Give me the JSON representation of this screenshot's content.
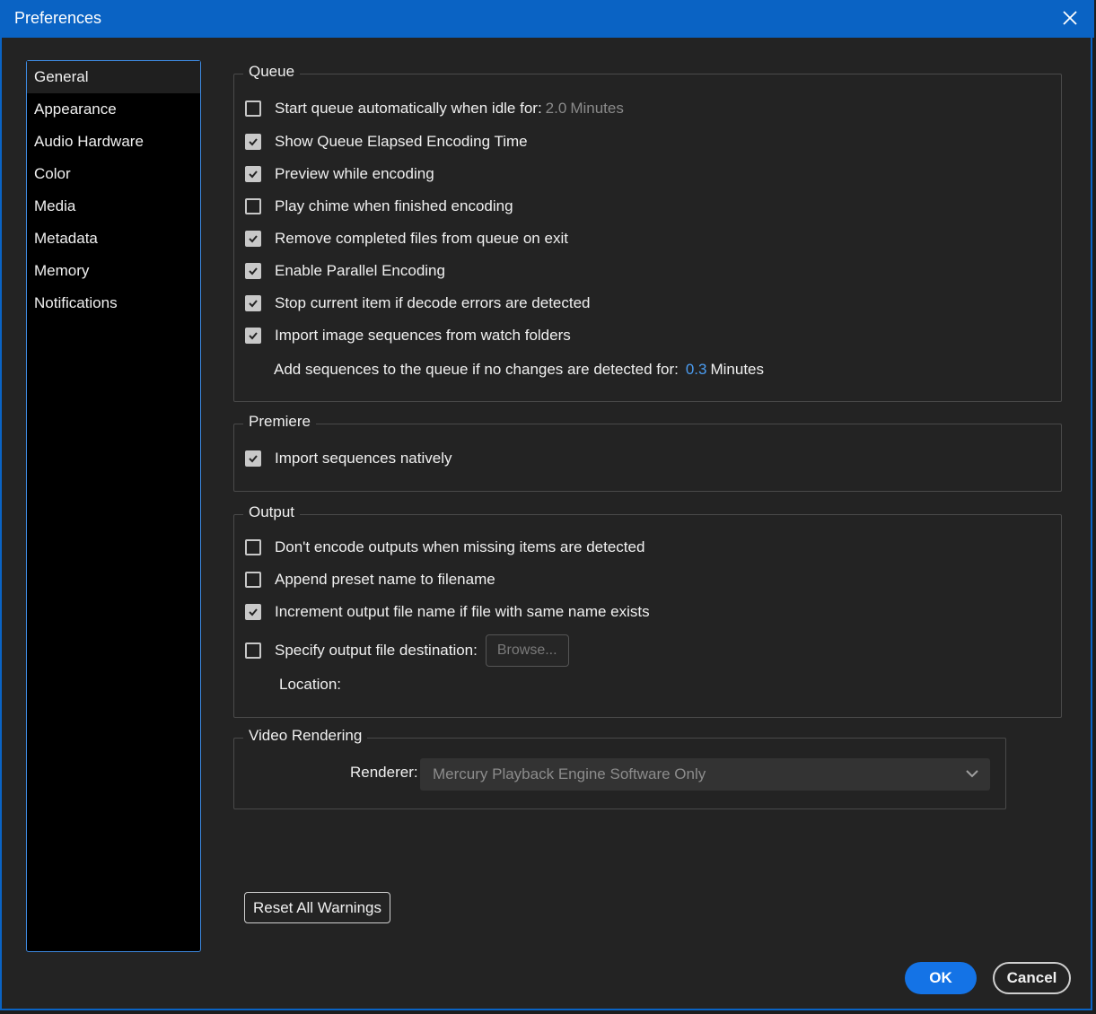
{
  "window": {
    "title": "Preferences"
  },
  "sidebar": {
    "items": [
      {
        "label": "General",
        "active": true
      },
      {
        "label": "Appearance"
      },
      {
        "label": "Audio Hardware"
      },
      {
        "label": "Color"
      },
      {
        "label": "Media"
      },
      {
        "label": "Metadata"
      },
      {
        "label": "Memory"
      },
      {
        "label": "Notifications"
      }
    ]
  },
  "queue": {
    "legend": "Queue",
    "start_auto": {
      "label": "Start queue automatically when idle for:",
      "value": "2.0",
      "unit": "Minutes",
      "checked": false
    },
    "show_elapsed": {
      "label": "Show Queue Elapsed Encoding Time",
      "checked": true
    },
    "preview": {
      "label": "Preview while encoding",
      "checked": true
    },
    "chime": {
      "label": "Play chime when finished encoding",
      "checked": false
    },
    "remove_completed": {
      "label": "Remove completed files from queue on exit",
      "checked": true
    },
    "parallel": {
      "label": "Enable Parallel Encoding",
      "checked": true
    },
    "stop_decode": {
      "label": "Stop current item if decode errors are detected",
      "checked": true
    },
    "import_seq": {
      "label": "Import image sequences from watch folders",
      "checked": true
    },
    "add_seq": {
      "label": "Add sequences to the queue if no changes are detected for:",
      "value": "0.3",
      "unit": "Minutes"
    }
  },
  "premiere": {
    "legend": "Premiere",
    "import_native": {
      "label": "Import sequences natively",
      "checked": true
    }
  },
  "output": {
    "legend": "Output",
    "dont_encode": {
      "label": "Don't encode outputs when missing items are detected",
      "checked": false
    },
    "append_preset": {
      "label": "Append preset name to filename",
      "checked": false
    },
    "increment": {
      "label": "Increment output file name if file with same name exists",
      "checked": true
    },
    "specify_dest": {
      "label": "Specify output file destination:",
      "checked": false
    },
    "browse": "Browse...",
    "location_label": "Location:"
  },
  "video": {
    "legend": "Video Rendering",
    "renderer_label": "Renderer:",
    "renderer_value": "Mercury Playback Engine Software Only"
  },
  "buttons": {
    "reset": "Reset All Warnings",
    "ok": "OK",
    "cancel": "Cancel"
  },
  "colors": {
    "accent": "#1473e6",
    "titlebar": "#0a63c4"
  }
}
